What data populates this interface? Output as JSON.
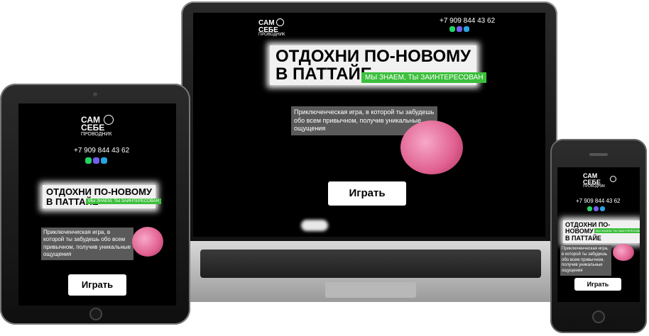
{
  "brand": {
    "logo_line1": "САМ",
    "logo_line2": "СЕБЕ",
    "logo_line3": "ПРОВОДНИК"
  },
  "contact": {
    "phone": "+7 909 844 43 62"
  },
  "messengers": [
    "whatsapp-icon",
    "viber-icon",
    "telegram-icon"
  ],
  "hero": {
    "title_line1": "ОТДОХНИ ПО-НОВОМУ",
    "title_line2": "В ПАТТАЙЕ",
    "badge": "МЫ ЗНАЕМ, ТЫ ЗАИНТЕРЕСОВАН",
    "description": "Приключенческая игра, в которой ты забудешь обо всем привычном, получив уникальные ощущения",
    "cta_label": "Играть"
  },
  "colors": {
    "accent_green": "#3cbf3c",
    "background": "#000000",
    "description_bg": "#5a5a5a"
  }
}
